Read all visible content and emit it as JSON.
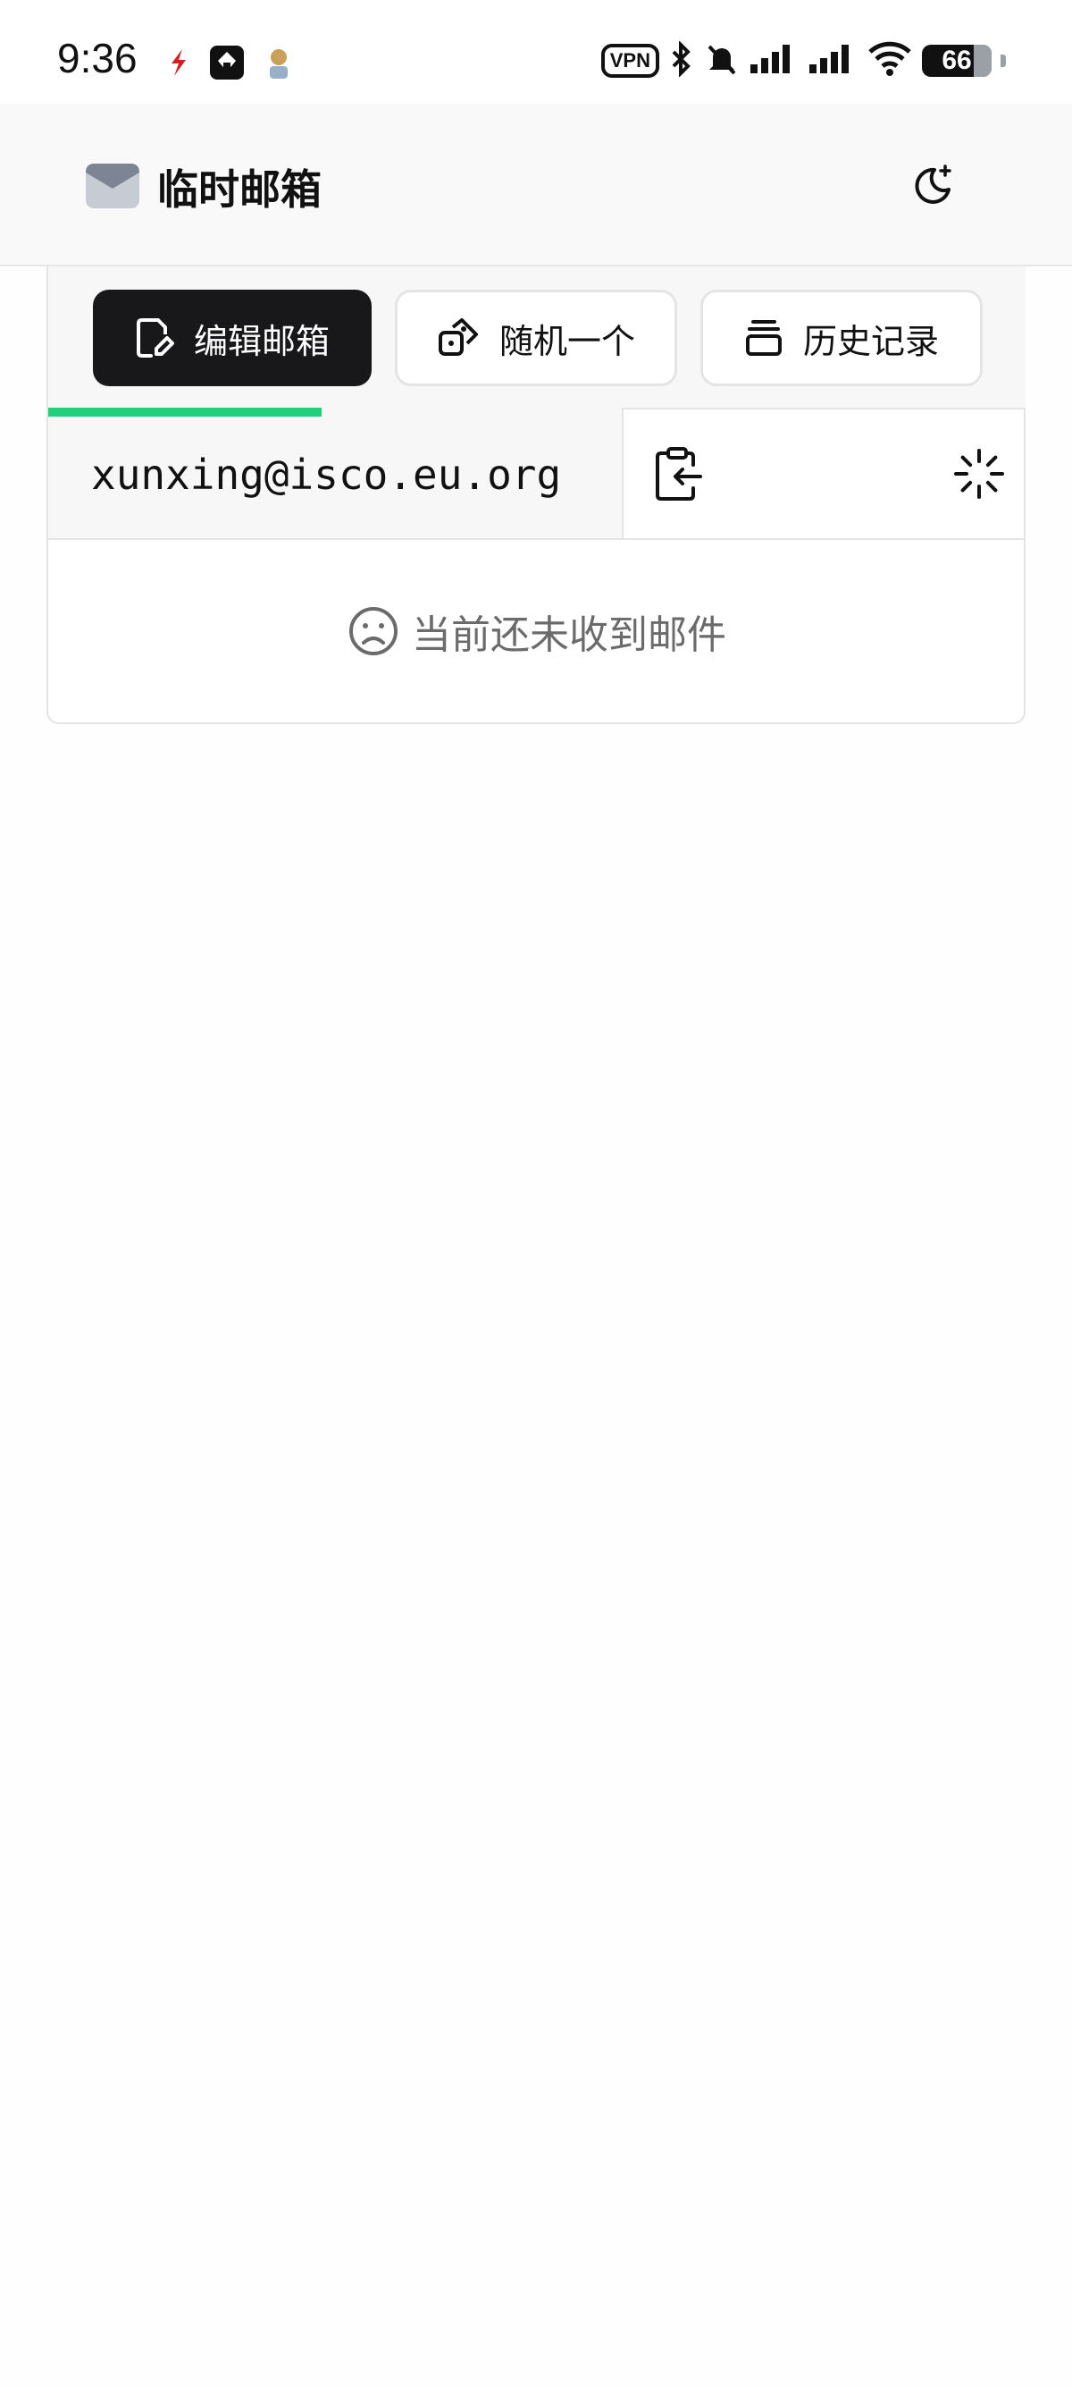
{
  "status_bar": {
    "time": "9:36",
    "vpn": "VPN",
    "battery": "66"
  },
  "header": {
    "title": "临时邮箱"
  },
  "toolbar": {
    "edit_label": "编辑邮箱",
    "random_label": "随机一个",
    "history_label": "历史记录"
  },
  "mailbox": {
    "address": "xunxing@isco.eu.org",
    "refresh_progress": 0.28
  },
  "inbox": {
    "empty_message": "当前还未收到邮件"
  },
  "colors": {
    "accent_progress": "#21d07a",
    "primary_button": "#18181b"
  }
}
